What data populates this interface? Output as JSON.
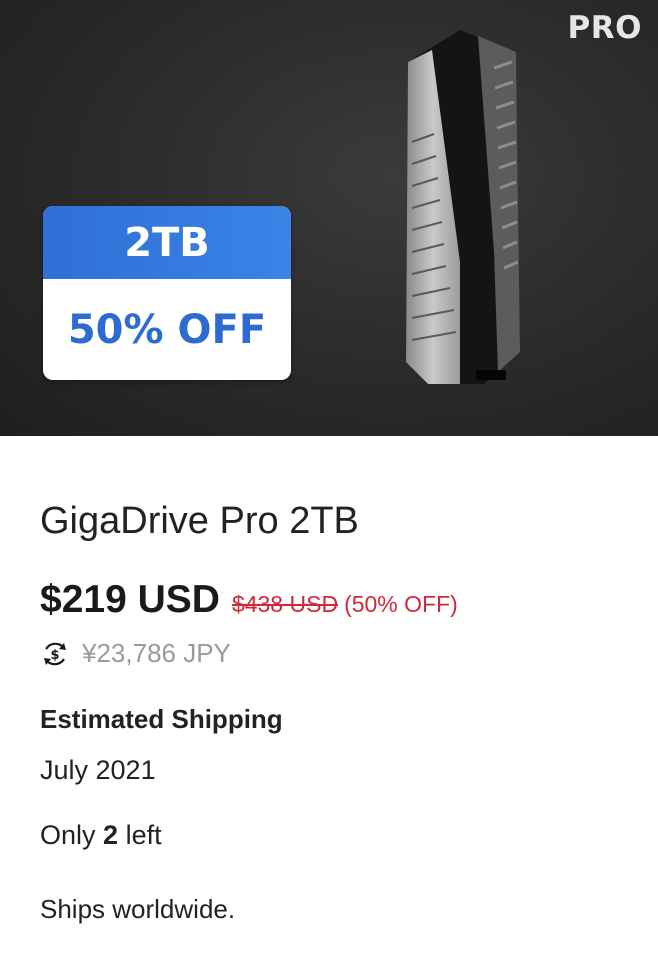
{
  "hero": {
    "tag": "PRO",
    "badge": {
      "capacity": "2TB",
      "discount": "50% OFF"
    },
    "image": "gigadrive-pro-product-photo"
  },
  "product": {
    "title": "GigaDrive Pro 2TB",
    "price": {
      "current": "$219 USD",
      "original": "$438 USD",
      "discount": "(50% OFF)",
      "converted": "¥23,786 JPY"
    },
    "shipping": {
      "label": "Estimated Shipping",
      "date": "July 2021"
    },
    "stock": {
      "prefix": "Only",
      "count": "2",
      "suffix": "left"
    },
    "ships_note": "Ships worldwide."
  },
  "icons": {
    "currency": "currency-exchange-icon"
  },
  "colors": {
    "badge_blue": "#3a84e6",
    "discount_red": "#d0283a",
    "muted_gray": "#9a9a9a"
  }
}
